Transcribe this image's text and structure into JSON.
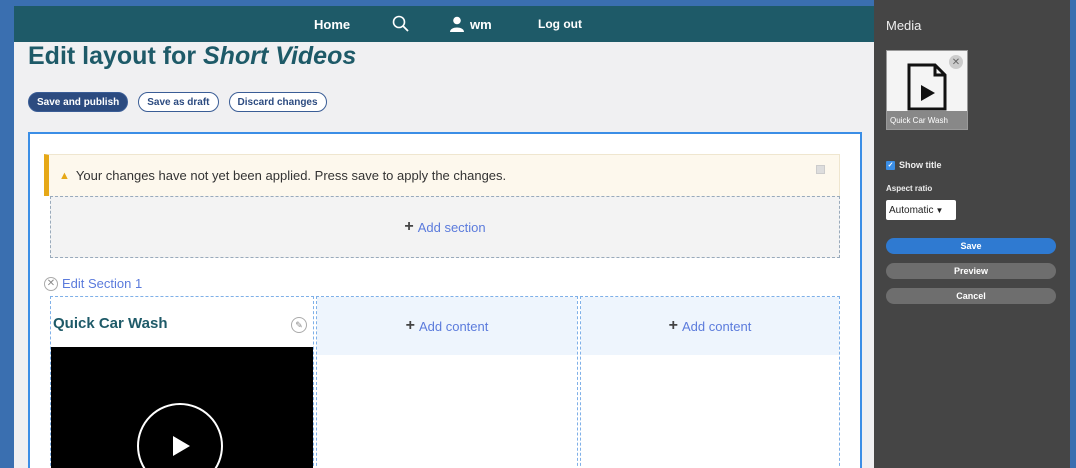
{
  "nav": {
    "home_label": "Home",
    "user_label": "wm",
    "logout_label": "Log out"
  },
  "page": {
    "title_prefix": "Edit layout for ",
    "title_emph": "Short Videos"
  },
  "actions": {
    "save_publish": "Save and publish",
    "save_draft": "Save as draft",
    "discard": "Discard changes"
  },
  "warning": {
    "text": "Your changes have not yet been applied. Press save to apply the changes."
  },
  "layout": {
    "add_section_label": "Add section",
    "edit_section_label": "Edit Section 1",
    "block_title": "Quick Car Wash",
    "add_content_label": "Add content"
  },
  "panel": {
    "title": "Media",
    "thumb_label": "Quick Car Wash",
    "show_title_label": "Show title",
    "aspect_ratio_label": "Aspect ratio",
    "aspect_ratio_value": "Automatic",
    "save_label": "Save",
    "preview_label": "Preview",
    "cancel_label": "Cancel"
  },
  "colors": {
    "brand": "#1e5a68",
    "accent": "#3b8ee6",
    "warning": "#e6a817"
  }
}
